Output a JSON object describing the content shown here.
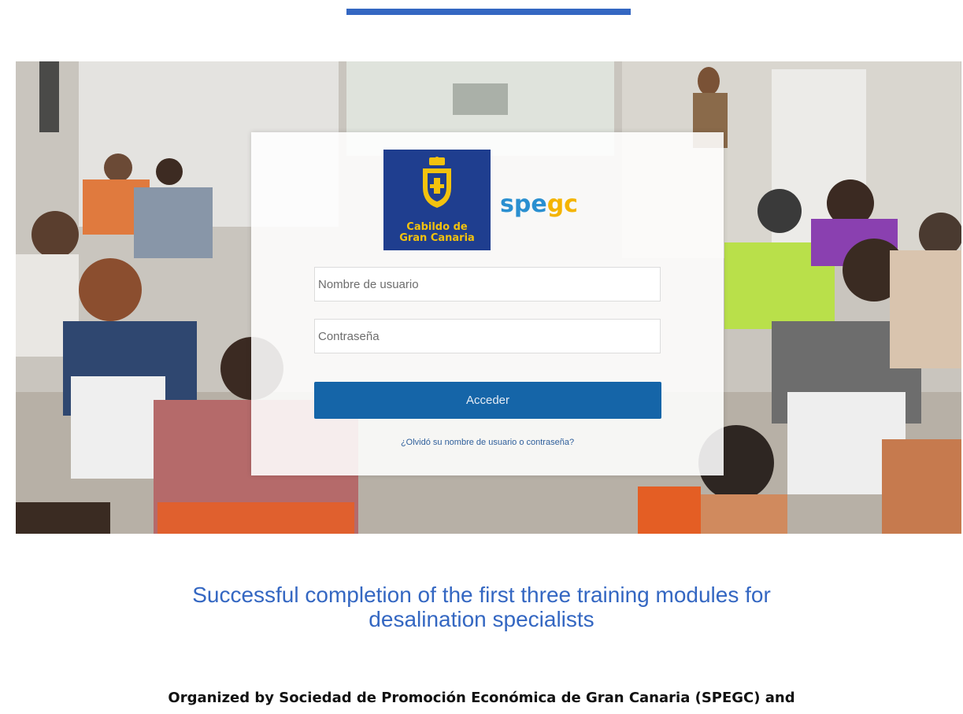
{
  "hero": {
    "image_description_icon": "classroom-photo"
  },
  "login": {
    "logo_cabildo_line1": "Cabildo de",
    "logo_cabildo_line2": "Gran Canaria",
    "logo_spegc_part1": "spe",
    "logo_spegc_part2": "gc",
    "username_placeholder": "Nombre de usuario",
    "password_placeholder": "Contraseña",
    "submit_label": "Acceder",
    "forgot_link": "¿Olvidó su nombre de usuario o contraseña?"
  },
  "article": {
    "headline_line1": "Successful completion of the first three training modules for",
    "headline_line2": "desalination specialists",
    "organized_text": "Organized by Sociedad de Promoción Económica de Gran Canaria (SPEGC) and"
  },
  "colors": {
    "accent": "#3467c2",
    "button": "#1565a8",
    "cabildo_blue": "#1f3e8f",
    "cabildo_yellow": "#f3c20e",
    "spegc_blue": "#2a8fd0",
    "spegc_yellow": "#f4b400"
  }
}
